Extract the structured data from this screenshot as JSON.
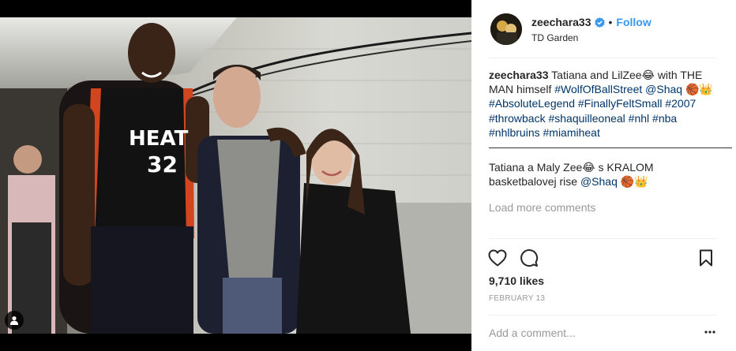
{
  "post": {
    "username": "zeechara33",
    "follow_label": "Follow",
    "separator": "•",
    "location": "TD Garden",
    "verified_icon": "verified-badge-icon",
    "accent": "#3897f0"
  },
  "photo": {
    "jersey_text": "HEAT",
    "jersey_number": "32"
  },
  "caption": {
    "username": "zeechara33",
    "text_1": " Tatiana and LilZee😂 with THE MAN himself ",
    "hashtag_1": "#WolfOfBallStreet",
    "mention_1": "@Shaq",
    "emoji_1": " 🏀👑",
    "hashtags_line": "#AbsoluteLegend #FinallyFeltSmall #2007 #throwback #shaquilleoneal #nhl #nba #nhlbruins #miamiheat",
    "divider": "——————————————————————",
    "text_2": "Tatiana a Maly Zee😂 s KRALOM basketbalovej rise ",
    "mention_2": "@Shaq",
    "emoji_2": " 🏀👑"
  },
  "comments": {
    "load_label": "Load more comments"
  },
  "actions": {
    "icons": [
      "heart-icon",
      "comment-icon",
      "bookmark-icon"
    ]
  },
  "likes": "9,710 likes",
  "date": "FEBRUARY 13",
  "comment_box": {
    "placeholder": "Add a comment...",
    "more_icon": "more-options-icon"
  }
}
